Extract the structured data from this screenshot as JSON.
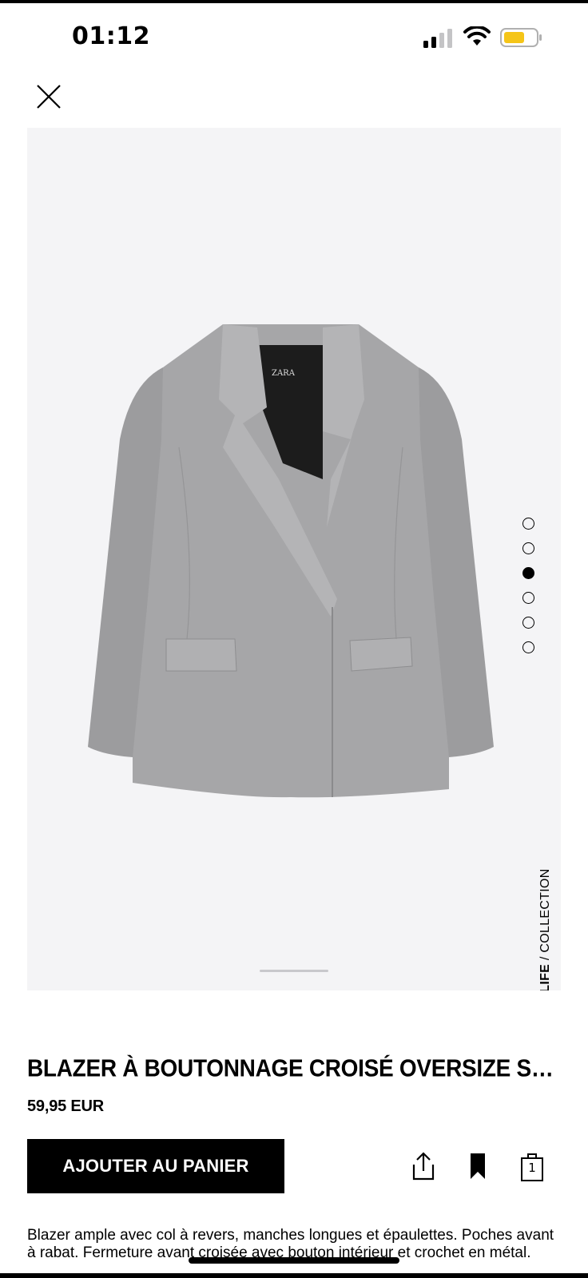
{
  "status_bar": {
    "time": "01:12"
  },
  "product": {
    "title": "BLAZER À BOUTONNAGE CROISÉ OVERSIZE SPECIAL…",
    "price": "59,95 EUR",
    "label_bold": "JOIN LIFE",
    "label_rest": " / COLLECTION",
    "description": "Blazer ample avec col à revers, manches longues et épaulettes. Poches avant à rabat. Fermeture avant croisée avec bouton intérieur et crochet en métal."
  },
  "gallery": {
    "total_images": 6,
    "active_index": 2
  },
  "actions": {
    "add_to_cart": "AJOUTER AU PANIER",
    "cart_count": "1"
  },
  "icons": [
    "close-icon",
    "share-icon",
    "bookmark-icon",
    "shopping-bag-icon",
    "signal-icon",
    "wifi-icon",
    "battery-icon"
  ],
  "colors": {
    "primary": "#000000",
    "image_bg": "#f4f4f6",
    "battery": "#f5c518"
  }
}
